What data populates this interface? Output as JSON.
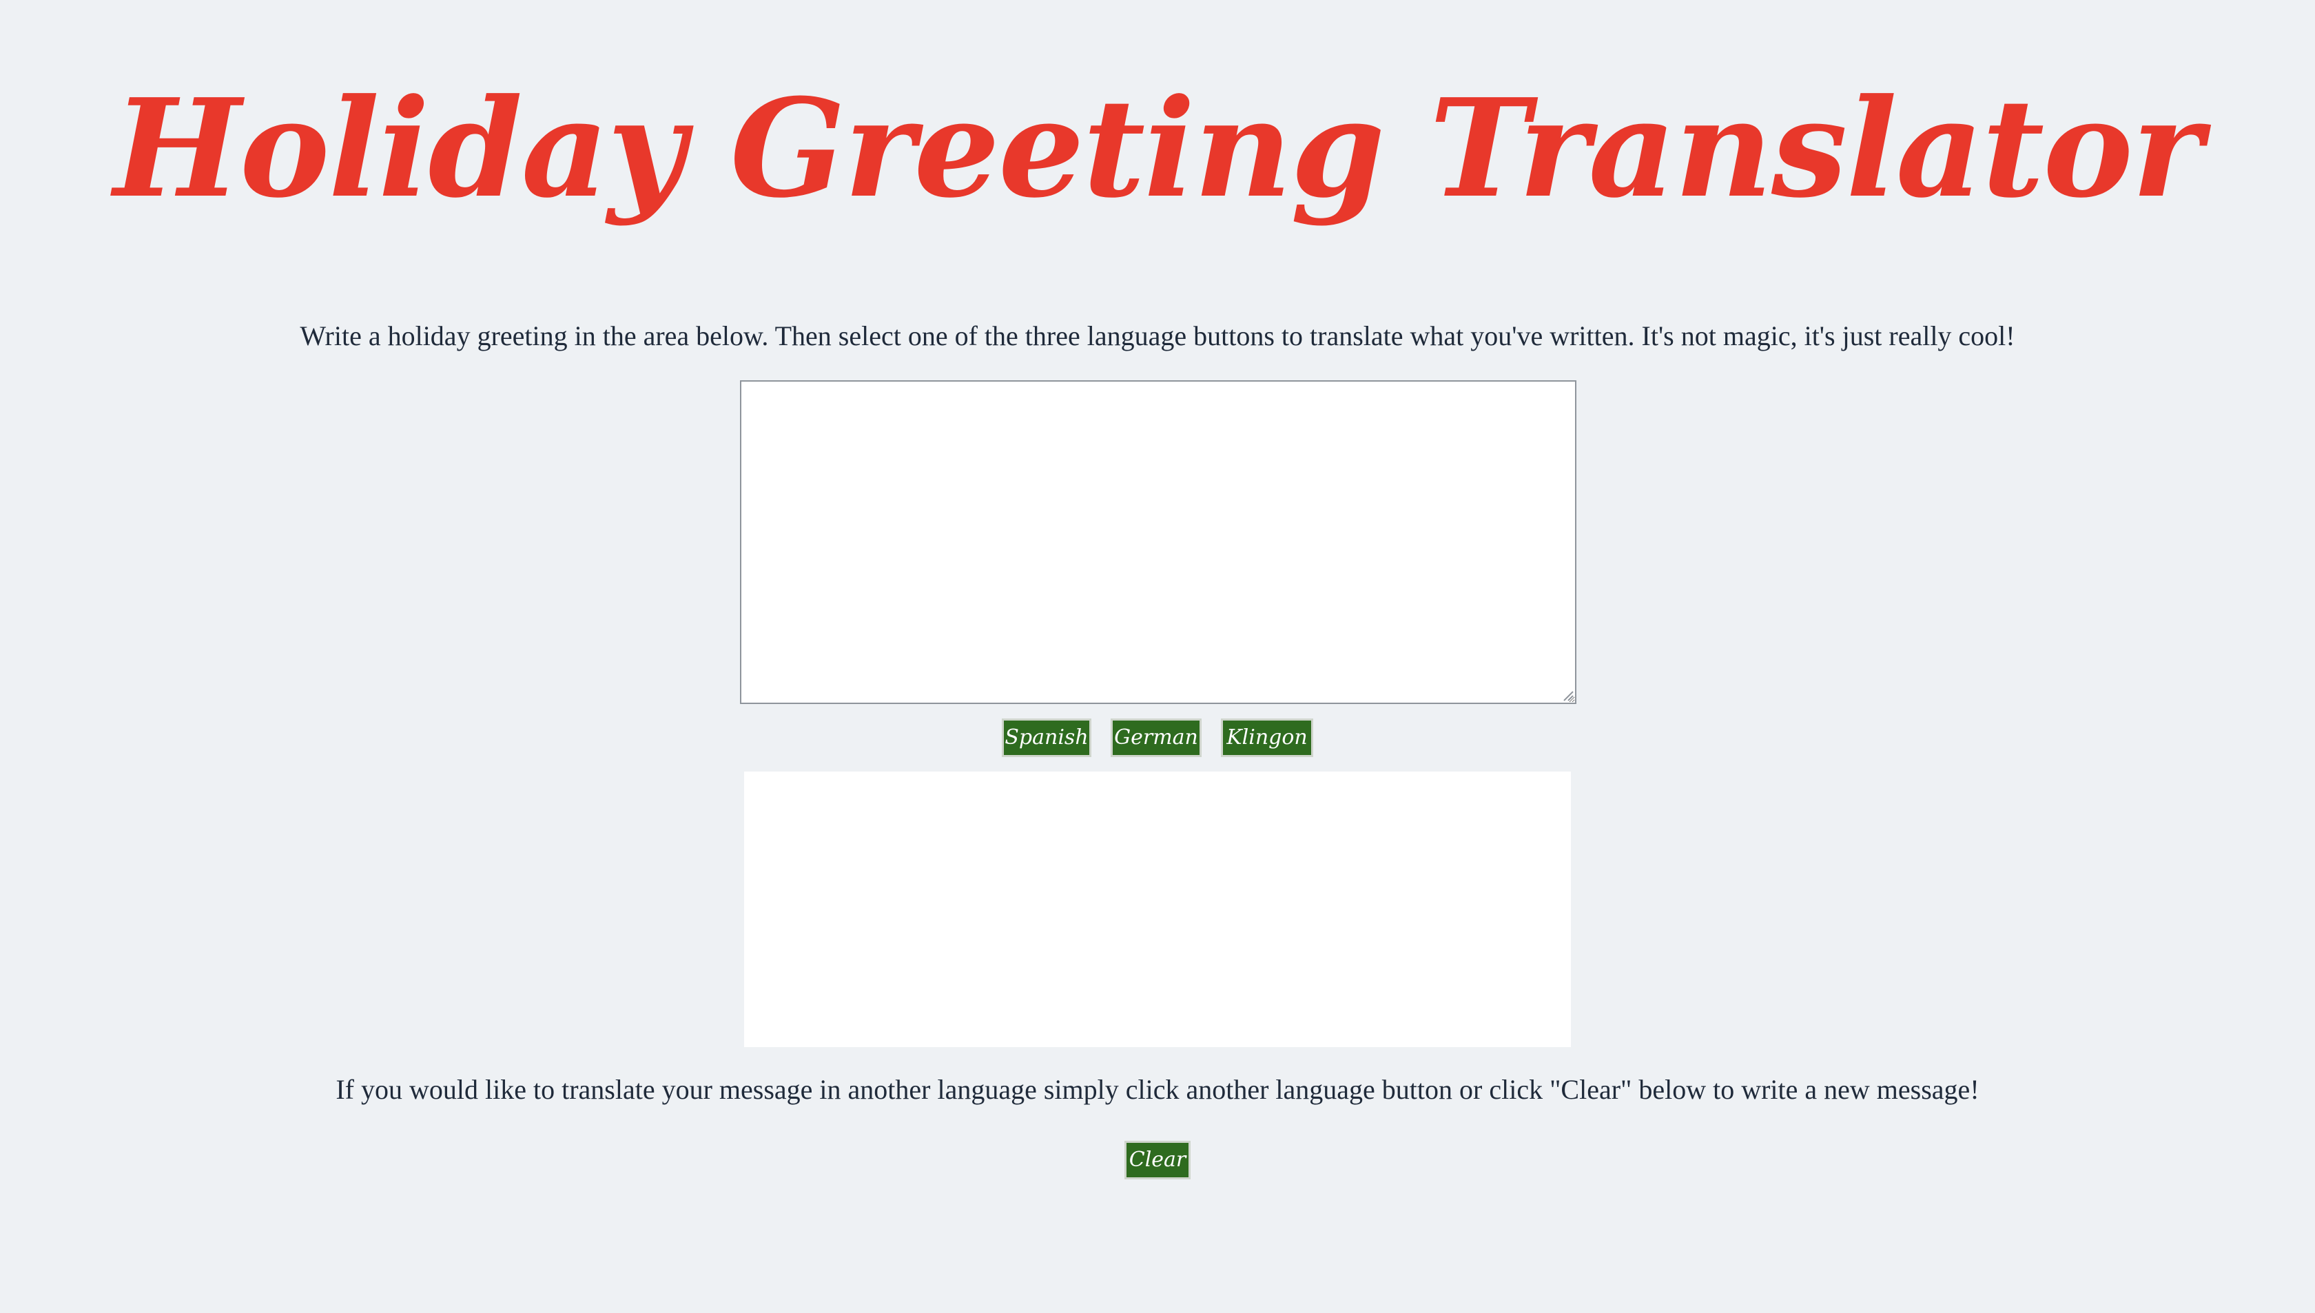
{
  "header": {
    "title": "Holiday Greeting Translator"
  },
  "intro": {
    "text": "Write a holiday greeting in the area below. Then select one of the three language buttons to translate what you've written. It's not magic, it's just really cool!"
  },
  "input": {
    "value": "",
    "placeholder": ""
  },
  "languages": {
    "spanish_label": "Spanish",
    "german_label": "German",
    "klingon_label": "Klingon"
  },
  "output": {
    "text": ""
  },
  "outro": {
    "text": "If you would like to translate your message in another language simply click another language button or click \"Clear\" below to write a new message!"
  },
  "actions": {
    "clear_label": "Clear"
  },
  "colors": {
    "background": "#eef1f4",
    "title": "#e8382b",
    "button": "#2e6b1f",
    "text": "#1f2a3a"
  }
}
